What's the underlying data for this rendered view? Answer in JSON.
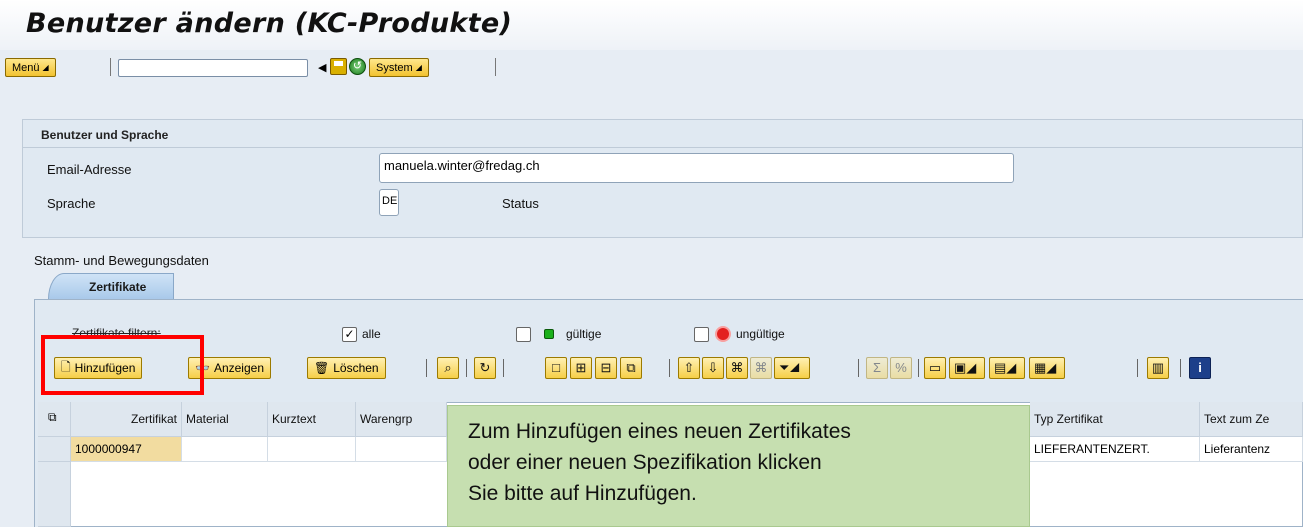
{
  "window": {
    "title": "Benutzer ändern (KC-Produkte)"
  },
  "menubar": {
    "menu_label": "Menü",
    "command_value": "",
    "system_label": "System"
  },
  "panel": {
    "title": "Benutzer und Sprache",
    "email_label": "Email-Adresse",
    "email_value": "manuela.winter@fredag.ch",
    "language_label": "Sprache",
    "language_value": "DE",
    "status_label": "Status"
  },
  "section": {
    "label": "Stamm- und Bewegungsdaten",
    "tab_label": "Zertifikate"
  },
  "filter": {
    "label": "Zertifikate filtern:",
    "all_label": "alle",
    "all_checked": true,
    "valid_label": "gültige",
    "valid_checked": false,
    "invalid_label": "ungültige",
    "invalid_checked": false
  },
  "toolbar": {
    "add_label": "Hinzufügen",
    "show_label": "Anzeigen",
    "delete_label": "Löschen"
  },
  "grid": {
    "columns": [
      "Zertifikat",
      "Material",
      "Kurztext",
      "Warengrp",
      "Typ Zertifikat",
      "Text zum Ze"
    ],
    "rows": [
      {
        "zertifikat": "1000000947",
        "material": "",
        "kurztext": "",
        "warengrp": "",
        "typ": "LIEFERANTENZERT.",
        "text": "Lieferantenz"
      }
    ]
  },
  "tooltip": {
    "line1": "Zum Hinzufügen eines neuen Zertifikates",
    "line2": "oder einer neuen Spezifikation klicken",
    "line3": "Sie bitte auf Hinzufügen."
  },
  "colors": {
    "highlight_box": "#ff0000",
    "tooltip_bg": "#c6dfb0",
    "button_yellow": "#f6cf48"
  }
}
